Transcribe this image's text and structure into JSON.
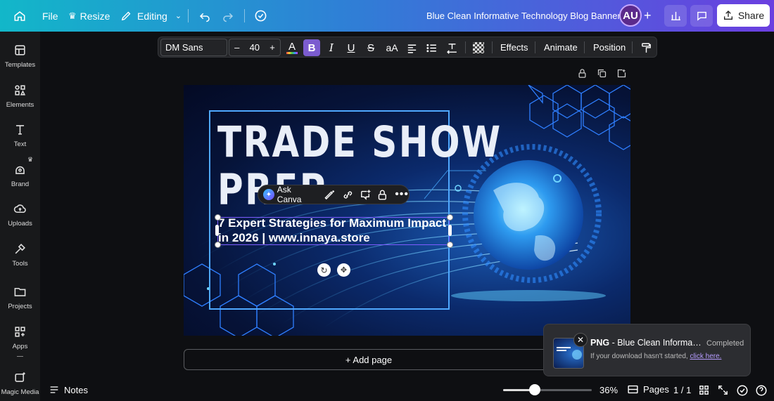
{
  "topbar": {
    "file_label": "File",
    "resize_label": "Resize",
    "editing_label": "Editing",
    "doc_title": "Blue Clean Informative Technology Blog Banner",
    "avatar_initials": "AU",
    "share_label": "Share"
  },
  "sidebar": {
    "items": [
      {
        "label": "Templates",
        "icon": "templates-icon"
      },
      {
        "label": "Elements",
        "icon": "elements-icon"
      },
      {
        "label": "Text",
        "icon": "text-icon"
      },
      {
        "label": "Brand",
        "icon": "brand-icon"
      },
      {
        "label": "Uploads",
        "icon": "uploads-icon"
      },
      {
        "label": "Tools",
        "icon": "tools-icon"
      },
      {
        "label": "Projects",
        "icon": "projects-icon"
      },
      {
        "label": "Apps",
        "icon": "apps-icon"
      },
      {
        "label": "Magic Media",
        "icon": "magic-media-icon"
      }
    ]
  },
  "format": {
    "font_name": "DM Sans",
    "font_size": "40",
    "minus": "–",
    "plus": "+",
    "effects_label": "Effects",
    "animate_label": "Animate",
    "position_label": "Position"
  },
  "design": {
    "title_line1": "TRADE SHOW",
    "title_line2": "PREP",
    "subtitle": "7 Expert Strategies for Maximum Impact in 2026 | www.innaya.store"
  },
  "floatbar": {
    "ask_canva_label": "Ask Canva"
  },
  "add_page_label": "+ Add page",
  "toast": {
    "format": "PNG",
    "filename": " - Blue Clean Informative Technology Blog Banner",
    "status": "Completed",
    "hint": "If your download hasn't started, ",
    "link": "click here."
  },
  "bottom": {
    "notes_label": "Notes",
    "zoom": "36%",
    "pages_label": "Pages",
    "page_count": "1 / 1",
    "zoom_level": 0.36
  },
  "colors": {
    "topbar_start": "#12b7c9",
    "topbar_end": "#6b3fe0",
    "accent": "#7b5ccf",
    "selection": "#7d5cff"
  }
}
